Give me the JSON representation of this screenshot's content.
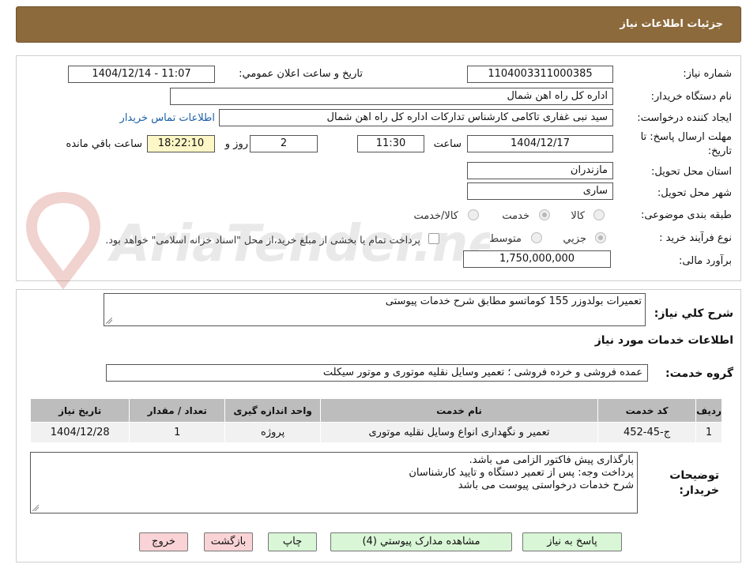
{
  "header": {
    "title": "جزئیات اطلاعات نیاز"
  },
  "form": {
    "need_number_label": "شماره نیاز:",
    "need_number": "1104003311000385",
    "announce_label": "تاریخ و ساعت اعلان عمومي:",
    "announce_value": "1404/12/14 - 11:07",
    "buyer_org_label": "نام دستگاه خريدار:",
    "buyer_org": "اداره کل راه اهن شمال",
    "creator_label": "ايجاد کننده درخواست:",
    "creator": "سید نبی غفاری تاکامی کارشناس تدارکات اداره کل راه اهن شمال",
    "contact_link": "اطلاعات تماس خريدار",
    "deadline_label_1": "مهلت ارسال پاسخ: تا",
    "deadline_label_2": "تاريخ:",
    "deadline_date": "1404/12/17",
    "time_label": "ساعت",
    "deadline_time": "11:30",
    "days_value": "2",
    "days_label": "روز و",
    "remaining_time": "18:22:10",
    "remaining_label": "ساعت باقي مانده",
    "province_label": "استان محل تحويل:",
    "province": "مازندران",
    "city_label": "شهر محل تحويل:",
    "city": "ساری",
    "category_label": "طبقه بندی موضوعی:",
    "category_options": [
      "کالا",
      "خدمت",
      "کالا/خدمت"
    ],
    "process_label": "نوع فرآيند خريد :",
    "process_options": [
      "جزیي",
      "متوسط"
    ],
    "payment_note": "پرداخت تمام يا بخشی از مبلغ خريد،از محل \"اسناد خزانه اسلامی\" خواهد بود.",
    "budget_label": "برآورد مالی:",
    "budget": "1,750,000,000"
  },
  "description": {
    "label": "شرح کلي نياز:",
    "text": "تعمیرات بولدوزر 155 کوماتسو مطابق شرح خدمات پیوستی"
  },
  "services": {
    "section_title": "اطلاعات خدمات مورد نياز",
    "group_label": "گروه خدمت:",
    "group_value": "عمده فروشی و خرده فروشی ؛ تعمیر وسایل نقلیه موتوری و موتور سیکلت",
    "table": {
      "headers": [
        "رديف",
        "کد خدمت",
        "نام خدمت",
        "واحد اندازه گيری",
        "تعداد / مقدار",
        "تاريخ نياز"
      ],
      "rows": [
        [
          "1",
          "ج-45-452",
          "تعمیر و نگهداری انواع وسایل نقلیه موتوری",
          "پروژه",
          "1",
          "1404/12/28"
        ]
      ]
    }
  },
  "buyer_notes": {
    "label_1": "توضيحات",
    "label_2": "خريدار:",
    "lines": [
      "بارگذاری پیش فاکتور الزامی می باشد.",
      "پرداخت وجه: پس از تعمیر دستگاه و تایید کارشناسان",
      "شرح خدمات درخواستی پیوست می باشد"
    ]
  },
  "buttons": {
    "reply": "پاسخ به نياز",
    "attachments": "مشاهده مدارک پيوستي (4)",
    "print": "چاپ",
    "back": "بازگشت",
    "exit": "خروج"
  },
  "watermark_text": "AriaTender.net",
  "colors": {
    "header": "#8d6a3b",
    "link": "#1b5fa8",
    "button_green": "#d9f6d6",
    "button_pink": "#f9d3d6",
    "highlight": "#fdf6c6"
  }
}
